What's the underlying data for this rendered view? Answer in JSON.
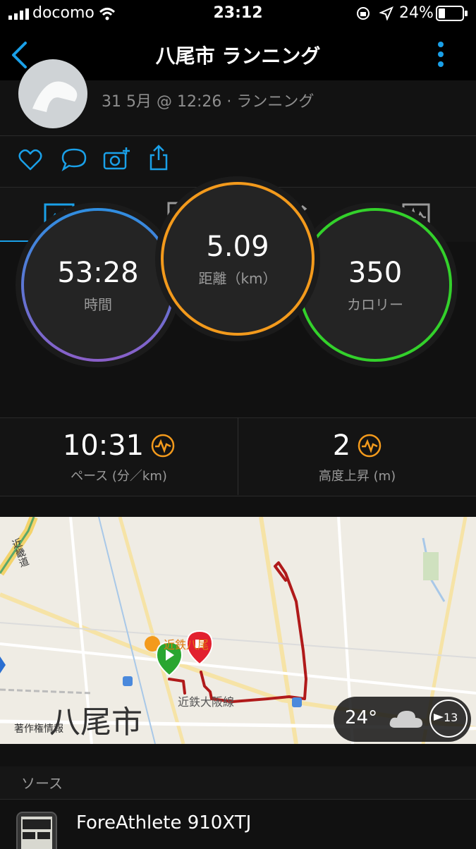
{
  "status_bar": {
    "carrier": "docomo",
    "time": "23:12",
    "battery": "24%"
  },
  "header": {
    "title": "八尾市 ランニング"
  },
  "activity": {
    "meta": "31 5月 @ 12:26 · ランニング"
  },
  "summary": {
    "time": {
      "value": "53:28",
      "label": "時間"
    },
    "distance": {
      "value": "5.09",
      "label": "距離（km）"
    },
    "calories": {
      "value": "350",
      "label": "カロリー"
    }
  },
  "stats": {
    "pace": {
      "value": "10:31",
      "label": "ペース (分／km)"
    },
    "elevation": {
      "value": "2",
      "label": "高度上昇 (m)"
    }
  },
  "map": {
    "city_label": "八尾市",
    "line_label": "近鉄大阪線",
    "road_label": "近畿道",
    "station_label": "近鉄八尾",
    "copyright": "著作権情報",
    "weather_temp": "24°",
    "wind_speed": "13"
  },
  "sources": {
    "heading": "ソース",
    "device_name": "ForeAthlete 910XTJ"
  },
  "colors": {
    "accent": "#1aa0e8",
    "orange": "#f39a1c",
    "green": "#33d12b",
    "route": "#b01a1a"
  }
}
